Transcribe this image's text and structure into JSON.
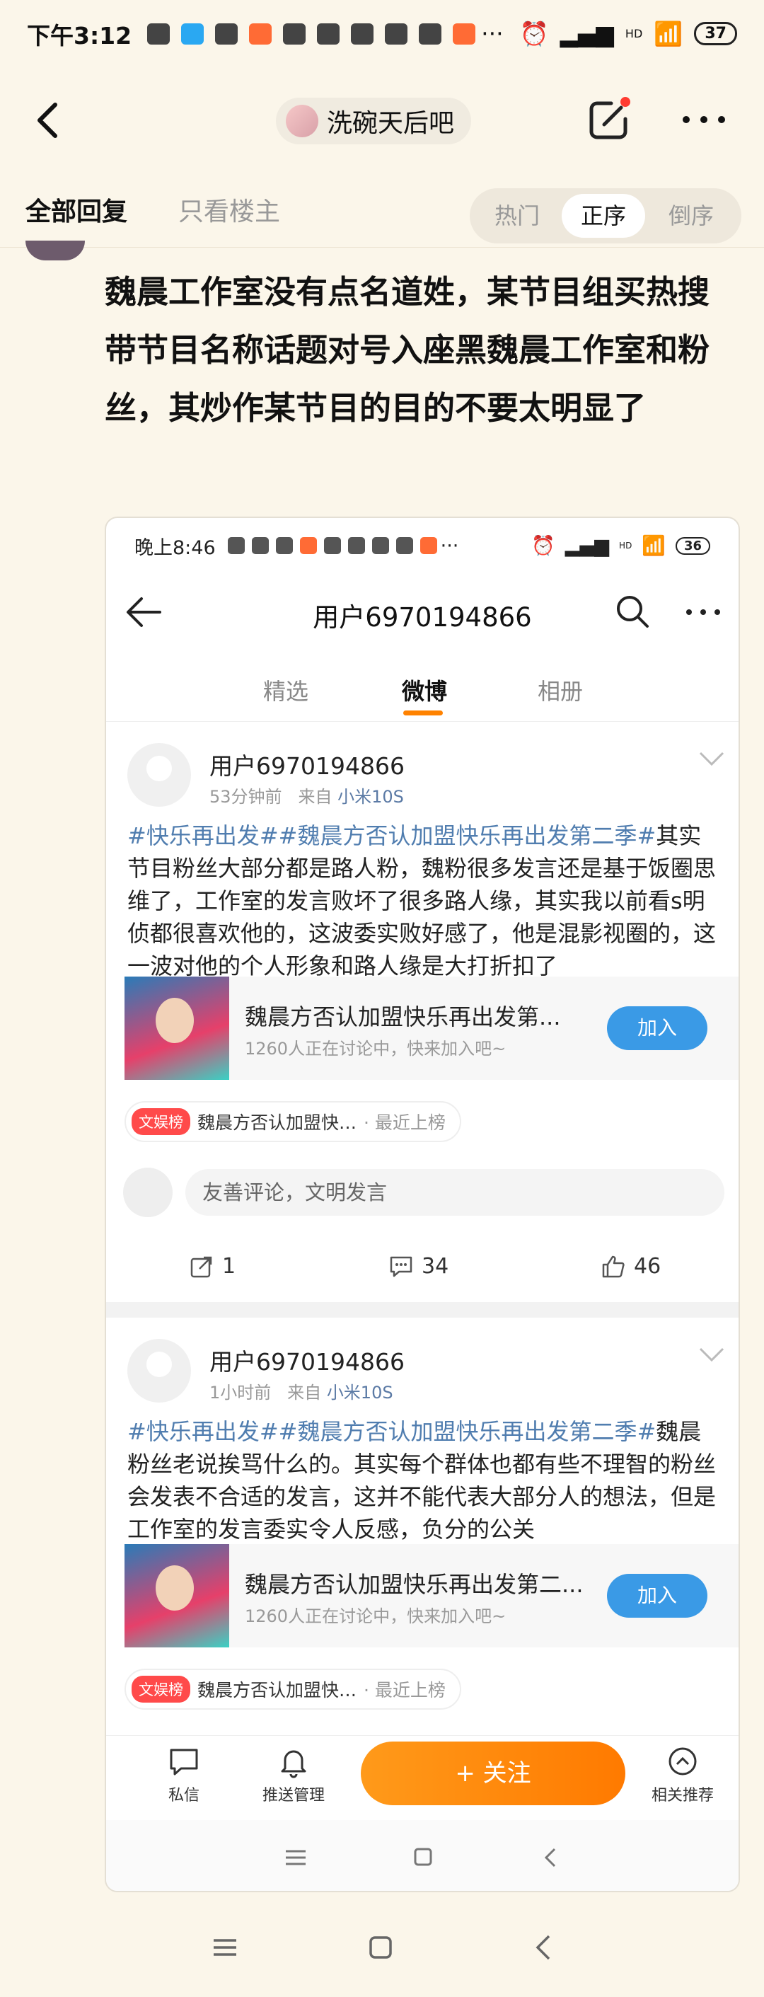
{
  "status_bar": {
    "time": "下午3:12",
    "hd": "HD",
    "battery": "37"
  },
  "nav": {
    "forum_name": "洗碗天后吧"
  },
  "tabs": {
    "all": "全部回复",
    "owner_only": "只看楼主",
    "sort": [
      "热门",
      "正序",
      "倒序"
    ],
    "active_sort": "正序"
  },
  "post": {
    "text": "魏晨工作室没有点名道姓，某节目组买热搜带节目名称话题对号入座黑魏晨工作室和粉丝，其炒作某节目的目的不要太明显了"
  },
  "screenshot": {
    "status_bar": {
      "time": "晚上8:46",
      "hd": "HD",
      "battery": "36"
    },
    "title": "用户6970194866",
    "tabs": [
      "精选",
      "微博",
      "相册"
    ],
    "active_tab": "微博",
    "cards": [
      {
        "user": "用户6970194866",
        "time": "53分钟前",
        "from_label": "来自",
        "device": "小米10S",
        "tags": "#快乐再出发##魏晨方否认加盟快乐再出发第二季#",
        "text": "其实节目粉丝大部分都是路人粉，魏粉很多发言还是基于饭圈思维了，工作室的发言败坏了很多路人缘，其实我以前看s明侦都很喜欢他的，这波委实败好感了，他是混影视圈的，这一波对他的个人形象和路人缘是大打折扣了",
        "topic_title": "魏晨方否认加盟快乐再出发第...",
        "topic_sub": "1260人正在讨论中，快来加入吧~",
        "join": "加入",
        "badge": "文娱榜",
        "badge_text": "魏晨方否认加盟快…",
        "badge_sub": "· 最近上榜",
        "comment_placeholder": "友善评论，文明发言",
        "reposts": "1",
        "comments": "34",
        "likes": "46"
      },
      {
        "user": "用户6970194866",
        "time": "1小时前",
        "from_label": "来自",
        "device": "小米10S",
        "tags": "#快乐再出发##魏晨方否认加盟快乐再出发第二季#",
        "text": "魏晨粉丝老说挨骂什么的。其实每个群体也都有些不理智的粉丝会发表不合适的发言，这并不能代表大部分人的想法，但是工作室的发言委实令人反感，负分的公关",
        "topic_title": "魏晨方否认加盟快乐再出发第二...",
        "topic_sub": "1260人正在讨论中，快来加入吧~",
        "join": "加入",
        "badge": "文娱榜",
        "badge_text": "魏晨方否认加盟快…",
        "badge_sub": "· 最近上榜"
      }
    ],
    "bottom": {
      "message": "私信",
      "push": "推送管理",
      "follow": "+ 关注",
      "related": "相关推荐"
    }
  }
}
